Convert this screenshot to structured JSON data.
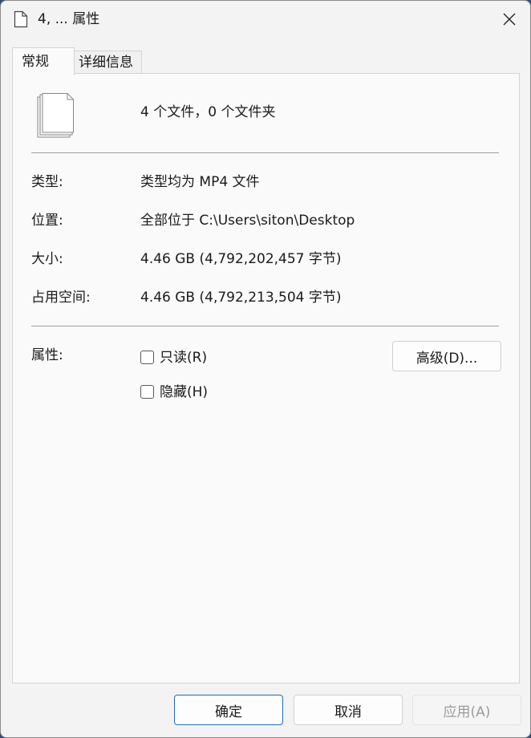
{
  "window": {
    "title": "4, ... 属性"
  },
  "tabs": [
    {
      "label": "常规",
      "active": true
    },
    {
      "label": "详细信息",
      "active": false
    }
  ],
  "general": {
    "summary": "4 个文件，0 个文件夹",
    "fields": {
      "type": {
        "label": "类型:",
        "value": "类型均为 MP4 文件"
      },
      "location": {
        "label": "位置:",
        "value": "全部位于 C:\\Users\\siton\\Desktop"
      },
      "size": {
        "label": "大小:",
        "value": "4.46 GB (4,792,202,457 字节)"
      },
      "size_on_disk": {
        "label": "占用空间:",
        "value": "4.46 GB (4,792,213,504 字节)"
      }
    },
    "attributes": {
      "label": "属性:",
      "readonly": {
        "label": "只读(R)",
        "checked": false
      },
      "hidden": {
        "label": "隐藏(H)",
        "checked": false
      },
      "advanced_label": "高级(D)..."
    }
  },
  "footer": {
    "ok_label": "确定",
    "cancel_label": "取消",
    "apply_label": "应用(A)"
  },
  "icons": {
    "title": "document-icon",
    "close": "close-icon",
    "files": "multiple-files-icon"
  },
  "colors": {
    "primary_border": "#1e6fb8",
    "window_bg": "#f3f3f3",
    "panel_bg": "#fafafa",
    "disabled_text": "#9b9b9b"
  }
}
